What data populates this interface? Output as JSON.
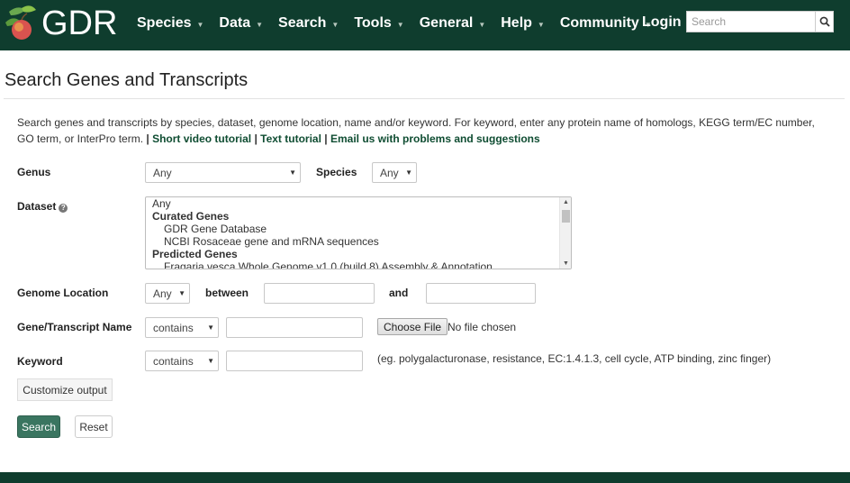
{
  "navbar": {
    "logo_text": "GDR",
    "menu": [
      {
        "label": "Species"
      },
      {
        "label": "Data"
      },
      {
        "label": "Search"
      },
      {
        "label": "Tools"
      },
      {
        "label": "General"
      },
      {
        "label": "Help"
      },
      {
        "label": "Community"
      }
    ],
    "login_label": "Login",
    "search_placeholder": "Search"
  },
  "page": {
    "title": "Search Genes and Transcripts",
    "description": "Search genes and transcripts by species, dataset, genome location, name and/or keyword. For keyword, enter any protein name of homologs, KEGG term/EC number, GO term, or InterPro term.",
    "sep": "|",
    "links": {
      "video": "Short video tutorial",
      "text": "Text tutorial",
      "email": "Email us with problems and suggestions"
    }
  },
  "form": {
    "genus_label": "Genus",
    "genus_value": "Any",
    "species_label": "Species",
    "species_value": "Any",
    "dataset_label": "Dataset",
    "dataset_options": {
      "any": "Any",
      "group1": "Curated Genes",
      "group1_items": [
        "GDR Gene Database",
        "NCBI Rosaceae gene and mRNA sequences"
      ],
      "group2": "Predicted Genes",
      "group2_partial": "Fragaria vesca Whole Genome v1.0 (build 8) Assembly & Annotation"
    },
    "location_label": "Genome Location",
    "location_value": "Any",
    "between_label": "between",
    "and_label": "and",
    "name_label": "Gene/Transcript Name",
    "name_op": "contains",
    "file_button": "Choose File",
    "file_status": "No file chosen",
    "keyword_label": "Keyword",
    "keyword_op": "contains",
    "keyword_hint": "(eg. polygalacturonase, resistance, EC:1.4.1.3, cell cycle, ATP binding, zinc finger)",
    "customize_label": "Customize output",
    "search_label": "Search",
    "reset_label": "Reset"
  },
  "colors": {
    "brand_dark": "#0f3d2e",
    "button_green": "#3a7560",
    "link_green": "#0f4d32"
  }
}
